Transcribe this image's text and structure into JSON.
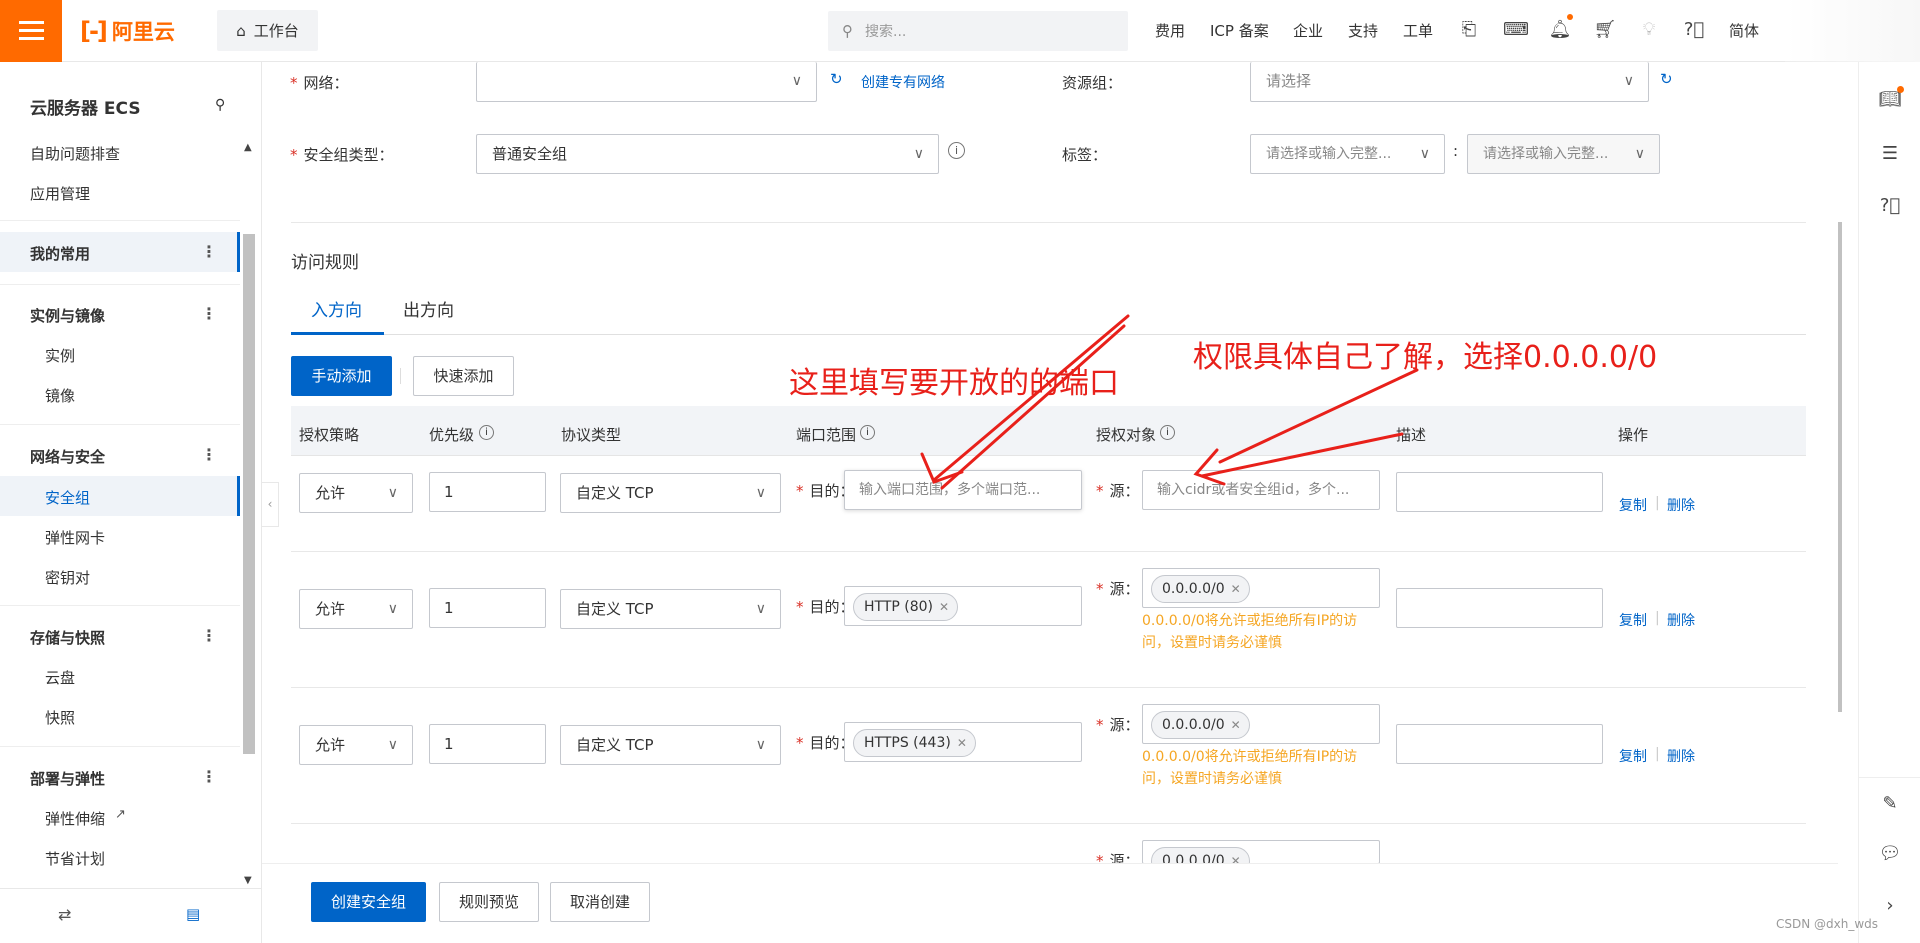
{
  "topbar": {
    "logo_text": "阿里云",
    "workbench": "工作台",
    "search_placeholder": "搜索...",
    "nav": [
      "费用",
      "ICP 备案",
      "企业",
      "支持",
      "工单"
    ],
    "lang": "简体"
  },
  "sidebar": {
    "title": "云服务器 ECS",
    "items": {
      "self_check": "自助问题排查",
      "app_mgmt": "应用管理",
      "favorites": "我的常用",
      "instances_group": "实例与镜像",
      "instance": "实例",
      "image": "镜像",
      "network_group": "网络与安全",
      "security_group": "安全组",
      "eni": "弹性网卡",
      "keypair": "密钥对",
      "storage_group": "存储与快照",
      "disk": "云盘",
      "snapshot": "快照",
      "deploy_group": "部署与弹性",
      "autoscaling": "弹性伸缩",
      "savings": "节省计划"
    }
  },
  "form": {
    "network_label": "网络：",
    "create_vpc": "创建专有网络",
    "resource_group_label": "资源组：",
    "resource_group_placeholder": "请选择",
    "sg_type_label": "安全组类型：",
    "sg_type_value": "普通安全组",
    "tag_label": "标签：",
    "tag_key_placeholder": "请选择或输入完整...",
    "tag_value_placeholder": "请选择或输入完整..."
  },
  "rules": {
    "section_title": "访问规则",
    "tab_in": "入方向",
    "tab_out": "出方向",
    "btn_manual": "手动添加",
    "btn_quick": "快速添加",
    "headers": {
      "policy": "授权策略",
      "priority": "优先级",
      "protocol": "协议类型",
      "port": "端口范围",
      "source": "授权对象",
      "desc": "描述",
      "ops": "操作"
    },
    "dest_label": "目的：",
    "src_label": "源：",
    "port_placeholder": "输入端口范围，多个端口范...",
    "source_placeholder": "输入cidr或者安全组id，多个...",
    "warning": "0.0.0.0/0将允许或拒绝所有IP的访问，设置时请务必谨慎",
    "copy": "复制",
    "delete": "删除",
    "rows": [
      {
        "policy": "允许",
        "priority": "1",
        "protocol": "自定义 TCP",
        "port_tag": "",
        "source_tag": ""
      },
      {
        "policy": "允许",
        "priority": "1",
        "protocol": "自定义 TCP",
        "port_tag": "HTTP (80)",
        "source_tag": "0.0.0.0/0"
      },
      {
        "policy": "允许",
        "priority": "1",
        "protocol": "自定义 TCP",
        "port_tag": "HTTPS (443)",
        "source_tag": "0.0.0.0/0"
      },
      {
        "source_tag": "0.0.0.0/0"
      }
    ]
  },
  "footer": {
    "create": "创建安全组",
    "preview": "规则预览",
    "cancel": "取消创建"
  },
  "annotations": {
    "port_note": "这里填写要开放的的端口",
    "source_note": "权限具体自己了解，选择0.0.0.0/0"
  },
  "watermark": "CSDN @dxh_wds",
  "colors": {
    "brand": "#ff6a00",
    "primary": "#0064c8",
    "warning": "#f5a623",
    "annotation": "#e8201a"
  }
}
